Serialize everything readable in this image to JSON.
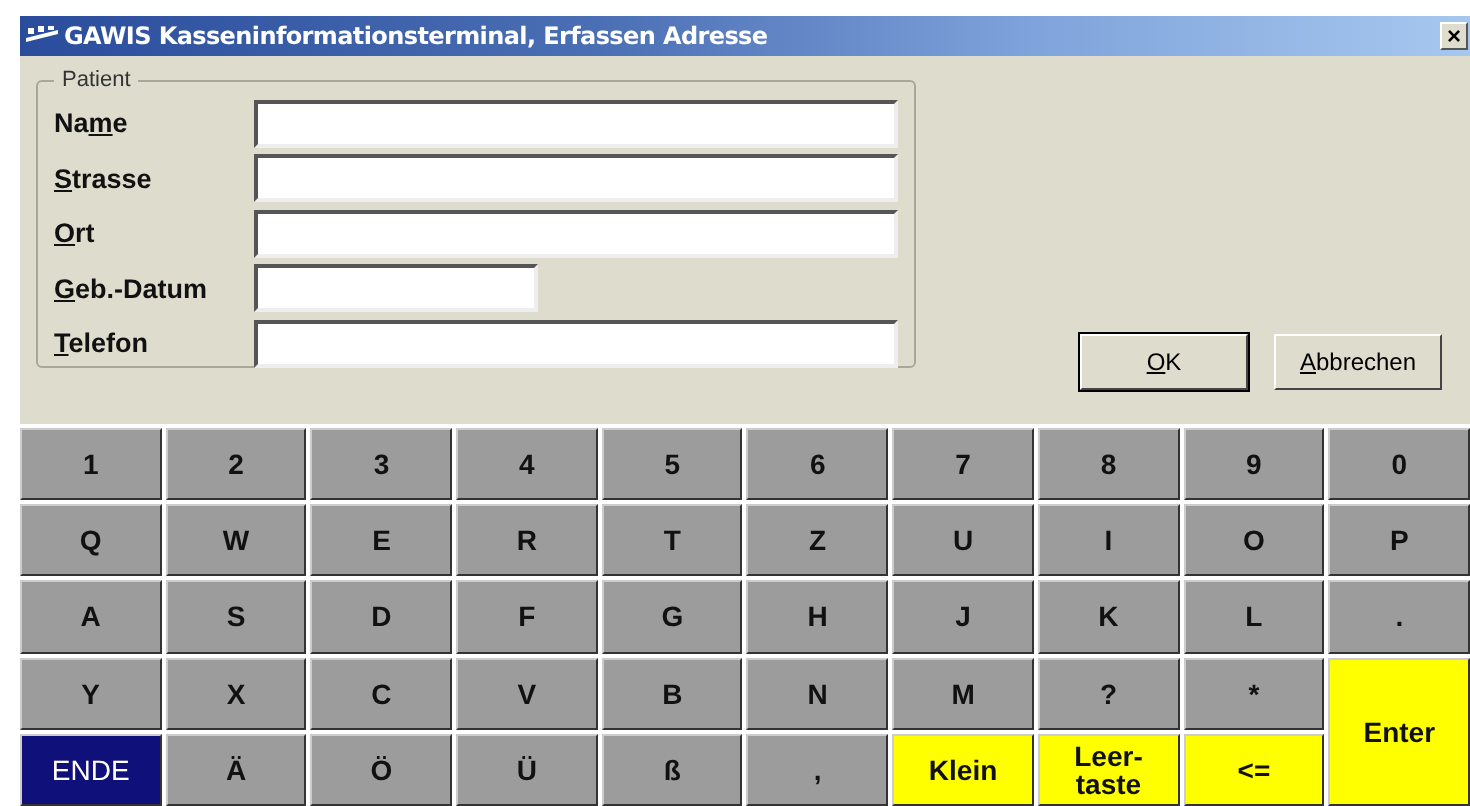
{
  "window": {
    "title": "GAWIS Kasseninformationsterminal, Erfassen Adresse",
    "close": "×"
  },
  "patient": {
    "legend": "Patient",
    "fields": [
      {
        "label_start": "Na",
        "access_key": "m",
        "label_end": "e",
        "short": false
      },
      {
        "access_key": "S",
        "label_end": "trasse",
        "short": false
      },
      {
        "access_key": "O",
        "label_end": "rt",
        "short": false
      },
      {
        "access_key": "G",
        "label_end": "eb.-Datum",
        "short": true
      },
      {
        "access_key": "T",
        "label_end": "elefon",
        "short": false
      }
    ]
  },
  "buttons": [
    {
      "access_key": "O",
      "label_end": "K",
      "default": true
    },
    {
      "access_key": "A",
      "label_end": "bbrechen",
      "default": false
    }
  ],
  "keyboard": [
    [
      {
        "label": "1",
        "kind": "key"
      },
      {
        "label": "2",
        "kind": "key"
      },
      {
        "label": "3",
        "kind": "key"
      },
      {
        "label": "4",
        "kind": "key"
      },
      {
        "label": "5",
        "kind": "key"
      },
      {
        "label": "6",
        "kind": "key"
      },
      {
        "label": "7",
        "kind": "key"
      },
      {
        "label": "8",
        "kind": "key"
      },
      {
        "label": "9",
        "kind": "key"
      },
      {
        "label": "0",
        "kind": "key"
      }
    ],
    [
      {
        "label": "Q",
        "kind": "key"
      },
      {
        "label": "W",
        "kind": "key"
      },
      {
        "label": "E",
        "kind": "key"
      },
      {
        "label": "R",
        "kind": "key"
      },
      {
        "label": "T",
        "kind": "key"
      },
      {
        "label": "Z",
        "kind": "key"
      },
      {
        "label": "U",
        "kind": "key"
      },
      {
        "label": "I",
        "kind": "key"
      },
      {
        "label": "O",
        "kind": "key"
      },
      {
        "label": "P",
        "kind": "key"
      }
    ],
    [
      {
        "label": "A",
        "kind": "key"
      },
      {
        "label": "S",
        "kind": "key"
      },
      {
        "label": "D",
        "kind": "key"
      },
      {
        "label": "F",
        "kind": "key"
      },
      {
        "label": "G",
        "kind": "key"
      },
      {
        "label": "H",
        "kind": "key"
      },
      {
        "label": "J",
        "kind": "key"
      },
      {
        "label": "K",
        "kind": "key"
      },
      {
        "label": "L",
        "kind": "key"
      },
      {
        "label": ".",
        "kind": "key"
      }
    ],
    [
      {
        "label": "Y",
        "kind": "key"
      },
      {
        "label": "X",
        "kind": "key"
      },
      {
        "label": "C",
        "kind": "key"
      },
      {
        "label": "V",
        "kind": "key"
      },
      {
        "label": "B",
        "kind": "key"
      },
      {
        "label": "N",
        "kind": "key"
      },
      {
        "label": "M",
        "kind": "key"
      },
      {
        "label": "?",
        "kind": "key"
      },
      {
        "label": "*",
        "kind": "key"
      },
      {
        "label": "Enter",
        "kind": "function",
        "tall": true
      }
    ],
    [
      {
        "label": "ENDE",
        "kind": "exit"
      },
      {
        "label": "Ä",
        "kind": "key"
      },
      {
        "label": "Ö",
        "kind": "key"
      },
      {
        "label": "Ü",
        "kind": "key"
      },
      {
        "label": "ß",
        "kind": "key"
      },
      {
        "label": ",",
        "kind": "key"
      },
      {
        "label": "Klein",
        "kind": "function"
      },
      {
        "label": "Leer-\ntaste",
        "kind": "function"
      },
      {
        "label": "<=",
        "kind": "function"
      }
    ]
  ]
}
